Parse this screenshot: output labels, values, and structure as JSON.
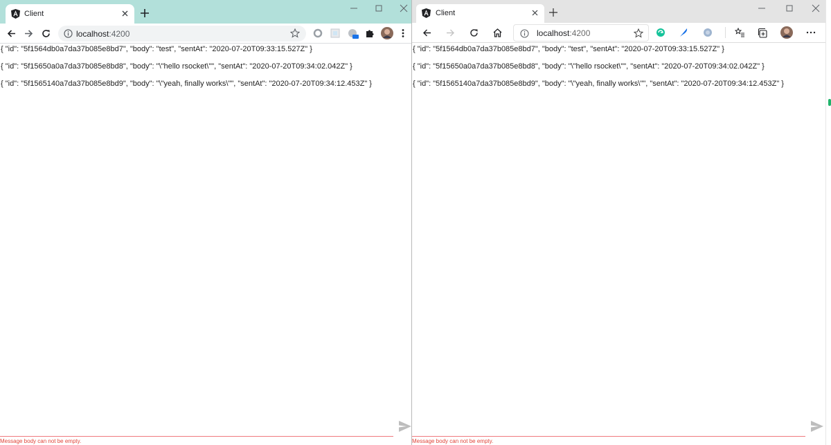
{
  "colors": {
    "chrome_tabstrip": "#b2e0da",
    "edge_tabstrip": "#e4e4e4",
    "error_red": "#e0453a",
    "send_gray": "#bdbdbd"
  },
  "chrome": {
    "tab_title": "Client",
    "url_host": "localhost",
    "url_port": ":4200",
    "messages": [
      "{ \"id\": \"5f1564db0a7da37b085e8bd7\", \"body\": \"test\", \"sentAt\": \"2020-07-20T09:33:15.527Z\" }",
      "{ \"id\": \"5f15650a0a7da37b085e8bd8\", \"body\": \"\\\"hello rsocket\\\"\", \"sentAt\": \"2020-07-20T09:34:02.042Z\" }",
      "{ \"id\": \"5f1565140a7da37b085e8bd9\", \"body\": \"\\\"yeah, finally works\\\"\", \"sentAt\": \"2020-07-20T09:34:12.453Z\" }"
    ],
    "input_value": "",
    "error_text": "Message body can not be empty."
  },
  "edge": {
    "tab_title": "Client",
    "url_host": "localhost",
    "url_port": ":4200",
    "messages": [
      "{ \"id\": \"5f1564db0a7da37b085e8bd7\", \"body\": \"test\", \"sentAt\": \"2020-07-20T09:33:15.527Z\" }",
      "{ \"id\": \"5f15650a0a7da37b085e8bd8\", \"body\": \"\\\"hello rsocket\\\"\", \"sentAt\": \"2020-07-20T09:34:02.042Z\" }",
      "{ \"id\": \"5f1565140a7da37b085e8bd9\", \"body\": \"\\\"yeah, finally works\\\"\", \"sentAt\": \"2020-07-20T09:34:12.453Z\" }"
    ],
    "input_value": "",
    "error_text": "Message body can not be empty."
  },
  "icons": {
    "favicon": "angular-icon",
    "back": "arrow-left-icon",
    "forward": "arrow-right-icon",
    "reload": "reload-icon",
    "home": "home-icon",
    "info": "info-icon",
    "star": "star-icon",
    "send": "send-icon"
  }
}
